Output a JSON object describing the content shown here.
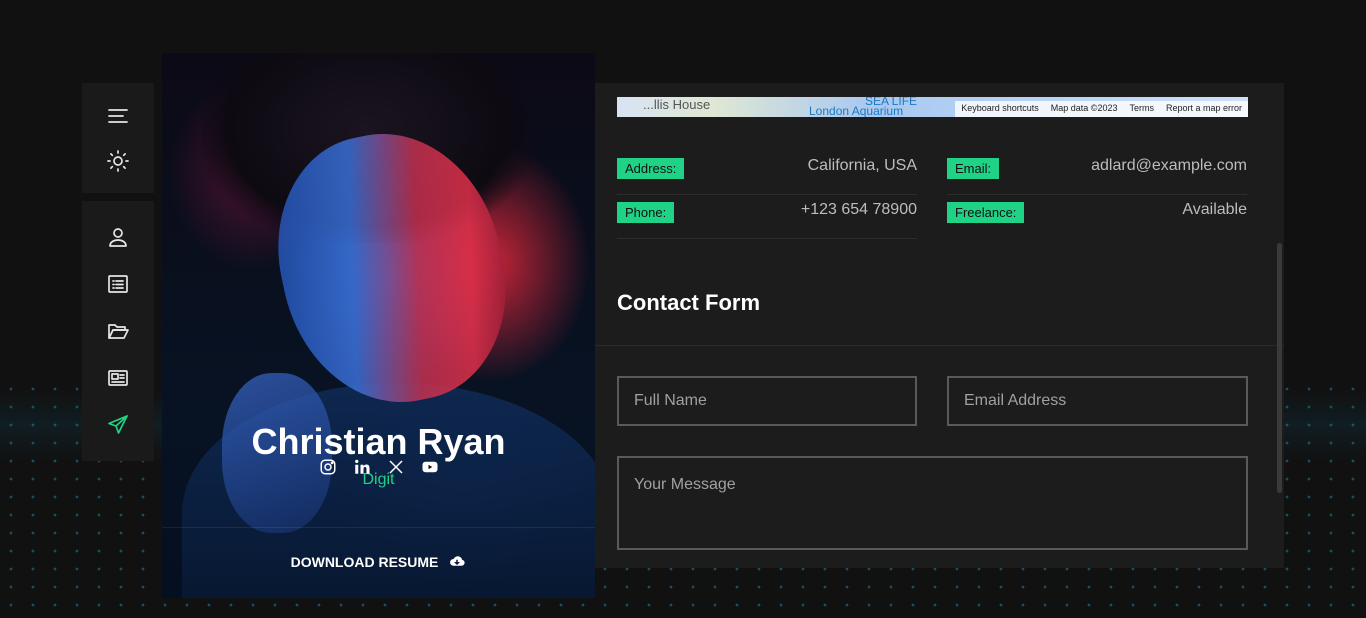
{
  "nav": {
    "top": [
      {
        "icon": "menu-icon"
      },
      {
        "icon": "sun-icon"
      }
    ],
    "items": [
      {
        "icon": "user-icon",
        "label": "About"
      },
      {
        "icon": "list-icon",
        "label": "Resume"
      },
      {
        "icon": "folder-icon",
        "label": "Portfolio"
      },
      {
        "icon": "news-icon",
        "label": "Blog"
      },
      {
        "icon": "send-icon",
        "label": "Contact",
        "active": true
      }
    ]
  },
  "profile": {
    "name": "Christian Ryan",
    "role": "Digit",
    "socials": [
      "instagram-icon",
      "linkedin-icon",
      "x-icon",
      "youtube-icon"
    ],
    "download_label": "DOWNLOAD RESUME"
  },
  "map": {
    "label_left": "...llis House",
    "label_sea": "SEA LIFE",
    "label_aquarium": "London Aquarium",
    "attribution": [
      "Keyboard shortcuts",
      "Map data ©2023",
      "Terms",
      "Report a map error"
    ]
  },
  "info": {
    "address_label": "Address:",
    "address_value": "California, USA",
    "email_label": "Email:",
    "email_value": "adlard@example.com",
    "phone_label": "Phone:",
    "phone_value": "+123 654 78900",
    "freelance_label": "Freelance:",
    "freelance_value": "Available"
  },
  "form": {
    "title": "Contact Form",
    "name_placeholder": "Full Name",
    "email_placeholder": "Email Address",
    "message_placeholder": "Your Message"
  },
  "colors": {
    "accent": "#1fd286",
    "background": "#111111",
    "panel": "#1c1c1c"
  }
}
